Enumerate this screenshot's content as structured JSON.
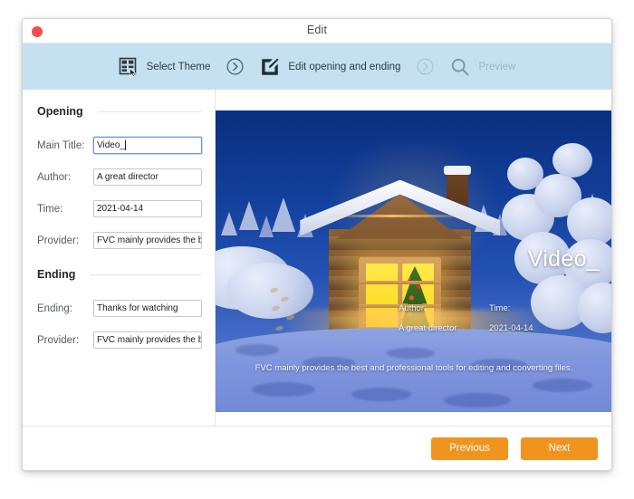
{
  "window": {
    "title": "Edit",
    "close_icon": "close-dot-icon"
  },
  "toolbar": {
    "steps": [
      {
        "label": "Select Theme",
        "icon": "theme-grid-icon",
        "state": "active"
      },
      {
        "label": "Edit opening and ending",
        "icon": "edit-pencil-square-icon",
        "state": "active"
      },
      {
        "label": "Preview",
        "icon": "magnifier-icon",
        "state": "disabled"
      }
    ],
    "separator_icon": "chevron-right-circle-icon",
    "background_color": "#c5e0ee"
  },
  "form": {
    "opening": {
      "heading": "Opening",
      "fields": [
        {
          "label": "Main Title:",
          "value": "Video_",
          "focused": true
        },
        {
          "label": "Author:",
          "value": "A great director",
          "focused": false
        },
        {
          "label": "Time:",
          "value": "2021-04-14",
          "focused": false
        },
        {
          "label": "Provider:",
          "value": "FVC mainly provides the best and professional tools for editing and converting files.",
          "focused": false
        }
      ]
    },
    "ending": {
      "heading": "Ending",
      "fields": [
        {
          "label": "Ending:",
          "value": "Thanks for watching",
          "focused": false
        },
        {
          "label": "Provider:",
          "value": "FVC mainly provides the best and professional tools for editing and converting files.",
          "focused": false
        }
      ]
    }
  },
  "preview": {
    "scene_description": "snow-covered log cabin at night with lit window and christmas tree",
    "title_overlay": "Video_",
    "author_label": "Author:",
    "author_value": "A great director",
    "time_label": "Time:",
    "time_value": "2021-04-14",
    "provider_text": "FVC mainly provides the best and professional tools for editing and converting files."
  },
  "footer": {
    "previous_label": "Previous",
    "next_label": "Next",
    "button_color": "#f1941f"
  }
}
